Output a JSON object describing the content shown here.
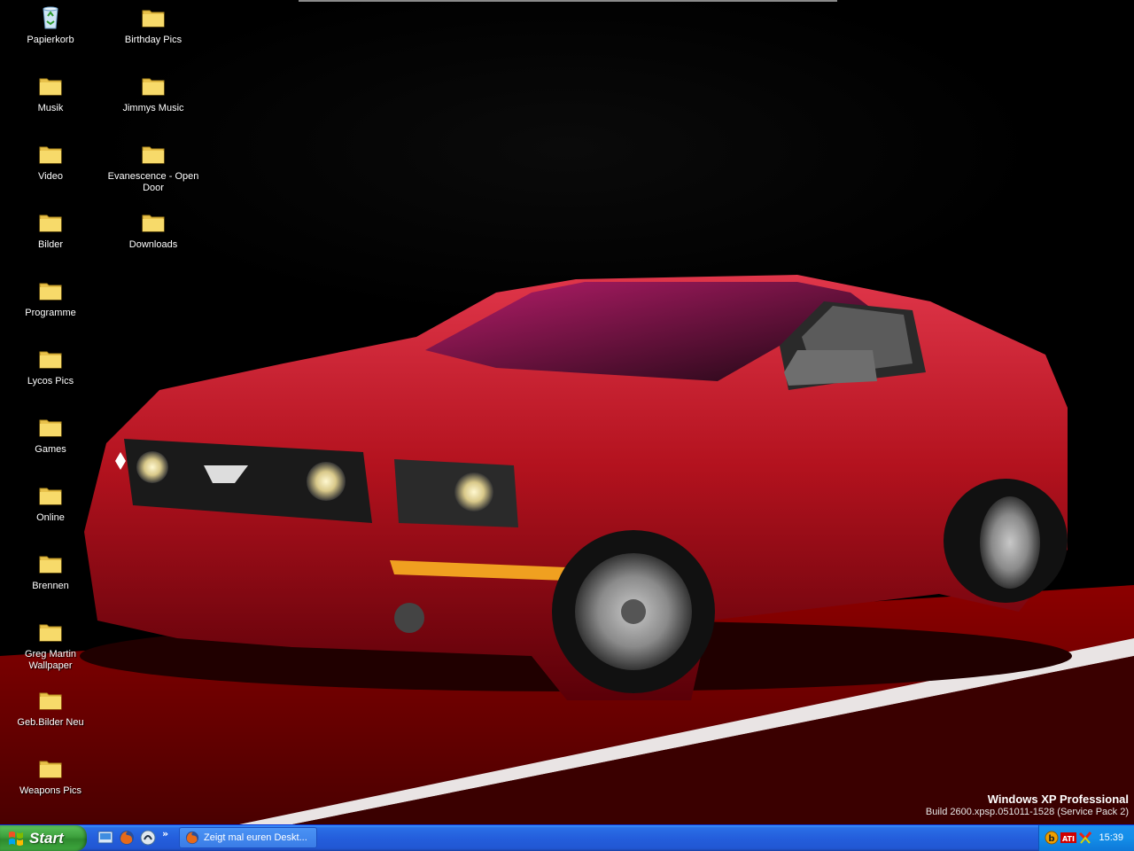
{
  "desktop": {
    "icons": [
      {
        "label": "Papierkorb",
        "kind": "recycle-bin"
      },
      {
        "label": "Birthday Pics",
        "kind": "folder"
      },
      {
        "label": "Musik",
        "kind": "folder"
      },
      {
        "label": "Jimmys Music",
        "kind": "folder"
      },
      {
        "label": "Video",
        "kind": "folder"
      },
      {
        "label": "Evanescence - Open Door",
        "kind": "folder"
      },
      {
        "label": "Bilder",
        "kind": "folder"
      },
      {
        "label": "Downloads",
        "kind": "folder"
      },
      {
        "label": "Programme",
        "kind": "folder"
      },
      {
        "label": "Lycos Pics",
        "kind": "folder"
      },
      {
        "label": "Games",
        "kind": "folder"
      },
      {
        "label": "Online",
        "kind": "folder"
      },
      {
        "label": "Brennen",
        "kind": "folder"
      },
      {
        "label": "Greg Martin Wallpaper",
        "kind": "folder"
      },
      {
        "label": "Geb.Bilder Neu",
        "kind": "folder"
      },
      {
        "label": "Weapons Pics",
        "kind": "folder"
      }
    ],
    "brand": {
      "name": "Windows XP Professional",
      "build": "Build 2600.xpsp.051011-1528 (Service Pack 2)"
    }
  },
  "taskbar": {
    "start_label": "Start",
    "quick_launch": [
      "show-desktop-icon",
      "firefox-icon",
      "media-player-icon"
    ],
    "task_item": "Zeigt mal euren Deskt...",
    "tray_icons": [
      "bitcomet-icon",
      "ati-icon",
      "antivirus-icon"
    ],
    "clock": "15:39"
  },
  "colors": {
    "taskbar": "#245edc",
    "start": "#3c9f3c",
    "tray": "#138ee8",
    "car": "#b3121e"
  }
}
